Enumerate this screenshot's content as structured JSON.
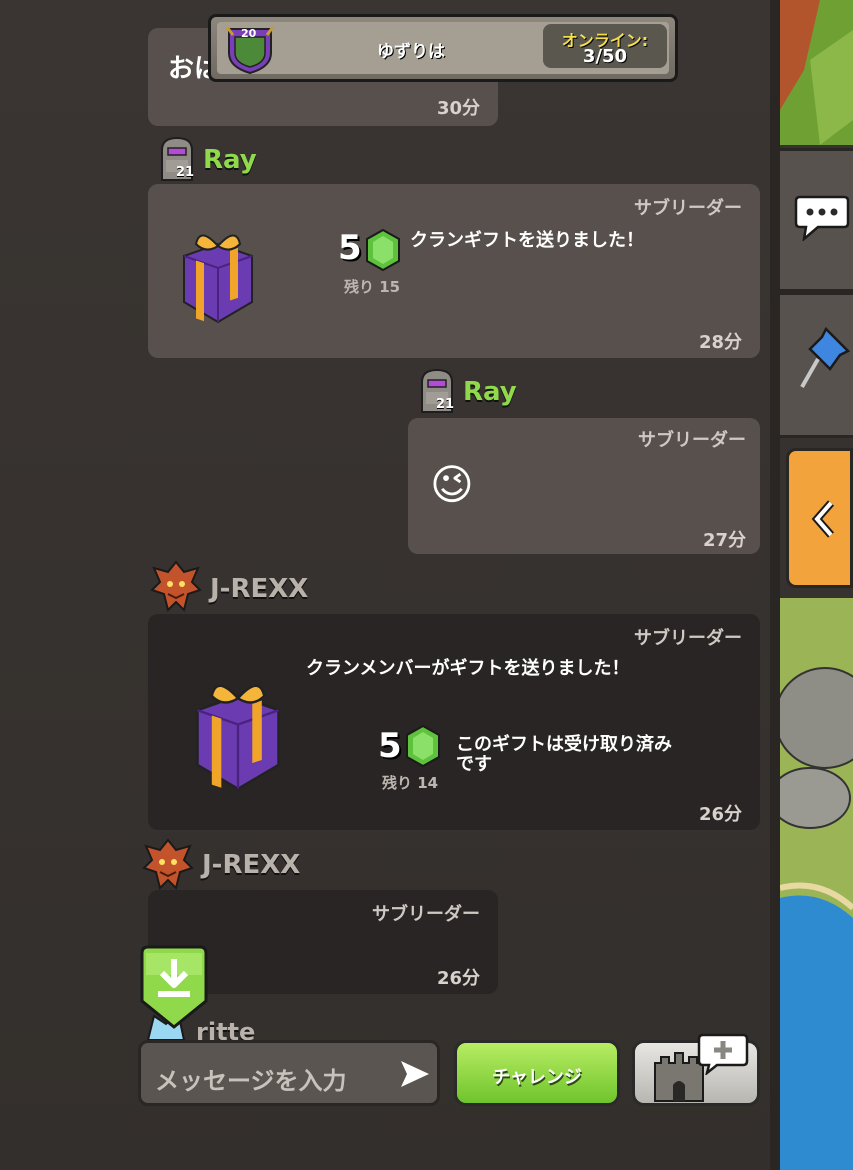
{
  "header": {
    "clan_level": "20",
    "clan_name": "ゆずりは",
    "online_label": "オンライン:",
    "online_count": "3/50"
  },
  "messages": [
    {
      "partial_text": "おは",
      "time": "30分"
    },
    {
      "sender": "Ray",
      "level": "21",
      "role": "サブリーダー",
      "gem_amount": "5",
      "remaining": "残り 15",
      "text": "クランギフトを送りました！",
      "time": "28分"
    },
    {
      "sender": "Ray",
      "level": "21",
      "role": "サブリーダー",
      "emoji": "😉",
      "time": "27分"
    },
    {
      "sender": "J-REXX",
      "role": "サブリーダー",
      "title": "クランメンバーがギフトを送りました！",
      "gem_amount": "5",
      "remaining": "残り 14",
      "text_line1": "このギフトは受け取り済み",
      "text_line2": "です",
      "time": "26分"
    },
    {
      "sender": "J-REXX",
      "role": "サブリーダー",
      "time": "26分"
    },
    {
      "sender_partial": "ritte"
    }
  ],
  "composer": {
    "placeholder": "メッセージを入力",
    "challenge_label": "チャレンジ"
  },
  "colors": {
    "name_green": "#8fd94a",
    "name_gray": "#b9b2ab",
    "challenge_green": "#8fd94a",
    "online_yellow": "#f5de4b",
    "side_orange": "#f3a33b"
  },
  "icons": [
    "clan-badge-icon",
    "gift-icon",
    "gem-icon",
    "builder-avatar-icon",
    "dragon-avatar-icon",
    "send-icon",
    "download-icon",
    "chat-bubble-icon",
    "pin-icon",
    "chevron-left-icon",
    "castle-icon",
    "plus-icon"
  ]
}
